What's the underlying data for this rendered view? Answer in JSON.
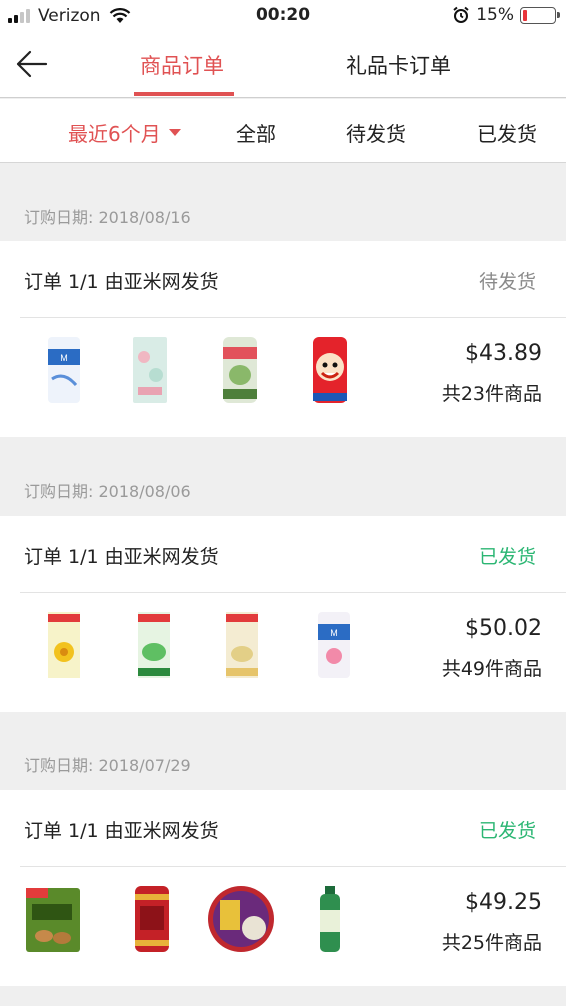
{
  "status_bar": {
    "carrier": "Verizon",
    "time": "00:20",
    "battery_percent": "15%"
  },
  "nav": {
    "tabs": [
      {
        "label": "商品订单",
        "active": true
      },
      {
        "label": "礼品卡订单",
        "active": false
      }
    ]
  },
  "filters": [
    {
      "label": "最近6个月",
      "active": true
    },
    {
      "label": "全部"
    },
    {
      "label": "待发货"
    },
    {
      "label": "已发货"
    }
  ],
  "colors": {
    "accent": "#e05253",
    "shipped": "#2bb673",
    "pending": "#8a8a8a"
  },
  "orders": [
    {
      "date": "订购日期: 2018/08/16",
      "header": "订单 1/1 由亚米网发货",
      "status": "待发货",
      "status_type": "pending",
      "price": "$43.89",
      "count": "共23件商品",
      "items": [
        "milkis-can",
        "pink-snack-pack",
        "melon-drink-can",
        "wangzai-milk-can"
      ]
    },
    {
      "date": "订购日期: 2018/08/06",
      "header": "订单 1/1 由亚米网发货",
      "status": "已发货",
      "status_type": "shipped",
      "price": "$50.02",
      "count": "共49件商品",
      "items": [
        "vita-chrysanthemum-drink",
        "vita-winter-melon-drink",
        "vita-soy-drink",
        "milkis-strawberry-can"
      ]
    },
    {
      "date": "订购日期: 2018/07/29",
      "header": "订单 1/1 由亚米网发货",
      "status": "已发货",
      "status_type": "shipped",
      "price": "$49.25",
      "count": "共25件商品",
      "items": [
        "honey-wasabi-almonds",
        "red-herbal-tea-can",
        "instant-noodle-bowl",
        "green-tea-bottle"
      ]
    }
  ]
}
